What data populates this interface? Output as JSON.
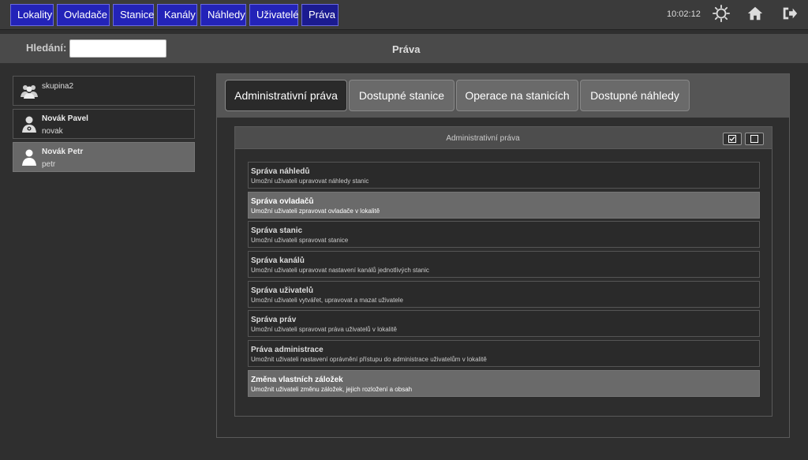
{
  "nav": {
    "items": [
      {
        "label": "Lokality"
      },
      {
        "label": "Ovladače"
      },
      {
        "label": "Stanice"
      },
      {
        "label": "Kanály"
      },
      {
        "label": "Náhledy"
      },
      {
        "label": "Uživatelé"
      },
      {
        "label": "Práva"
      }
    ],
    "active": "Práva",
    "clock": "10:02:12",
    "icons": [
      "settings-icon",
      "home-icon",
      "logout-icon"
    ]
  },
  "search": {
    "label": "Hledání:",
    "value": "",
    "placeholder": ""
  },
  "page": {
    "title": "Práva"
  },
  "users": [
    {
      "name": "skupina2",
      "login": "",
      "type": "group"
    },
    {
      "name": "Novák Pavel",
      "login": "novak",
      "type": "admin-user"
    },
    {
      "name": "Novák Petr",
      "login": "petr",
      "type": "user",
      "selected": true
    }
  ],
  "tabs": [
    {
      "label": "Administrativní práva"
    },
    {
      "label": "Dostupné stanice"
    },
    {
      "label": "Operace na stanicích"
    },
    {
      "label": "Dostupné náhledy"
    }
  ],
  "section": {
    "title": "Administrativní práva",
    "buttons": [
      "check-all-icon",
      "uncheck-all-icon"
    ]
  },
  "rights": [
    {
      "name": "Správa náhledů",
      "desc": "Umožní uživateli upravovat náhledy stanic",
      "enabled": false
    },
    {
      "name": "Správa ovladačů",
      "desc": "Umožní uživateli zpravovat ovladače v lokalitě",
      "enabled": true
    },
    {
      "name": "Správa stanic",
      "desc": "Umožní uživateli spravovat stanice",
      "enabled": false
    },
    {
      "name": "Správa kanálů",
      "desc": "Umožní uživateli upravovat nastavení kanálů jednotlivých stanic",
      "enabled": false
    },
    {
      "name": "Správa uživatelů",
      "desc": "Umožní uživateli vytvářet, upravovat a mazat uživatele",
      "enabled": false
    },
    {
      "name": "Správa práv",
      "desc": "Umožní uživateli spravovat práva uživatelů v lokalitě",
      "enabled": false
    },
    {
      "name": "Práva administrace",
      "desc": "Umožnit uživateli nastavení oprávnění přístupu do administrace uživatelům v lokalitě",
      "enabled": false
    },
    {
      "name": "Změna vlastních záložek",
      "desc": "Umožnit uživateli změnu záložek, jejich rozložení a obsah",
      "enabled": true
    }
  ],
  "colors": {
    "nav_button": "#2323b8",
    "background": "#2f2f2f",
    "selected_row": "#6a6a6a"
  }
}
